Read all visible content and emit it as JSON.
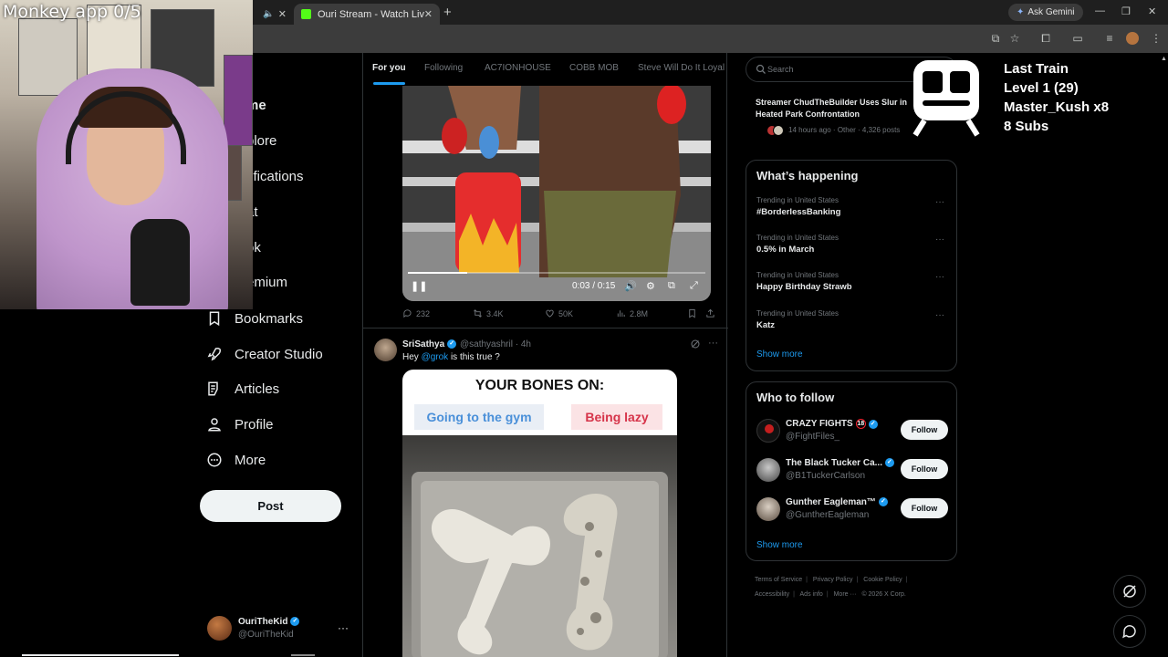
{
  "browser": {
    "tabs": [
      {
        "label": ""
      },
      {
        "label": "Ouri Stream - Watch Live on Ki"
      }
    ],
    "new_tab": "+",
    "ask_gemini": "Ask Gemini",
    "window_controls": {
      "minimize": "—",
      "restore": "❐",
      "close": "✕"
    }
  },
  "overlay": {
    "title": "Monkey app 0/5",
    "widget_lines": [
      "Last Train",
      "Level 1  (29)",
      "Master_Kush x8",
      "8 Subs"
    ]
  },
  "nav": {
    "partial_items": [
      "me",
      "plore",
      "tifications",
      "at",
      "ok",
      "emium"
    ],
    "items": [
      {
        "label": "Bookmarks",
        "icon": "bookmark-icon"
      },
      {
        "label": "Creator Studio",
        "icon": "rocket-icon"
      },
      {
        "label": "Articles",
        "icon": "articles-icon"
      },
      {
        "label": "Profile",
        "icon": "person-icon"
      },
      {
        "label": "More",
        "icon": "more-circle-icon"
      }
    ],
    "post_label": "Post",
    "account": {
      "name": "OuriTheKid",
      "handle": "@OuriTheKid",
      "menu": "···"
    }
  },
  "feed": {
    "tabs": [
      "For you",
      "Following",
      "AC7IONHOUSE",
      "COBB MOB",
      "Steve Will Do It Loyal"
    ],
    "video_post": {
      "time": "0:03 / 0:15",
      "progress": 0.2,
      "replies": "232",
      "reposts": "3.4K",
      "likes": "50K",
      "views": "2.8M"
    },
    "tweet": {
      "name": "SriSathya",
      "handle": "@sathyashril · 4h",
      "text_prefix": "Hey ",
      "mention": "@grok",
      "text_suffix": " is this true ?",
      "menu": "···",
      "meme": {
        "title": "YOUR BONES ON:",
        "left": "Going to the gym",
        "right": "Being lazy"
      }
    }
  },
  "sidebar": {
    "search_placeholder": "Search",
    "news": {
      "title": "Streamer ChudTheBuilder Uses Slur in Heated Park Confrontation",
      "meta": "14 hours ago · Other · 4,326 posts"
    },
    "happening": {
      "heading": "What’s happening",
      "trends": [
        {
          "context": "Trending in United States",
          "name": "#BorderlessBanking"
        },
        {
          "context": "Trending in United States",
          "name": "0.5% in March"
        },
        {
          "context": "Trending in United States",
          "name": "Happy Birthday Strawb"
        },
        {
          "context": "Trending in United States",
          "name": "Katz"
        }
      ],
      "show_more": "Show more",
      "more_glyph": "···"
    },
    "who_to_follow": {
      "heading": "Who to follow",
      "accounts": [
        {
          "name": "CRAZY FIGHTS",
          "badge": "18",
          "handle": "@FightFiles_",
          "button": "Follow"
        },
        {
          "name": "The Black Tucker Ca...",
          "handle": "@B1TuckerCarlson",
          "button": "Follow"
        },
        {
          "name": "Gunther Eagleman™",
          "handle": "@GuntherEagleman",
          "button": "Follow"
        }
      ],
      "show_more": "Show more"
    },
    "footer": [
      "Terms of Service",
      "Privacy Policy",
      "Cookie Policy",
      "Accessibility",
      "Ads info",
      "More ···",
      "© 2026 X Corp."
    ]
  },
  "colors": {
    "accent": "#1d9bf0",
    "background": "#000000",
    "border": "#2f3336",
    "muted": "#71767b"
  }
}
